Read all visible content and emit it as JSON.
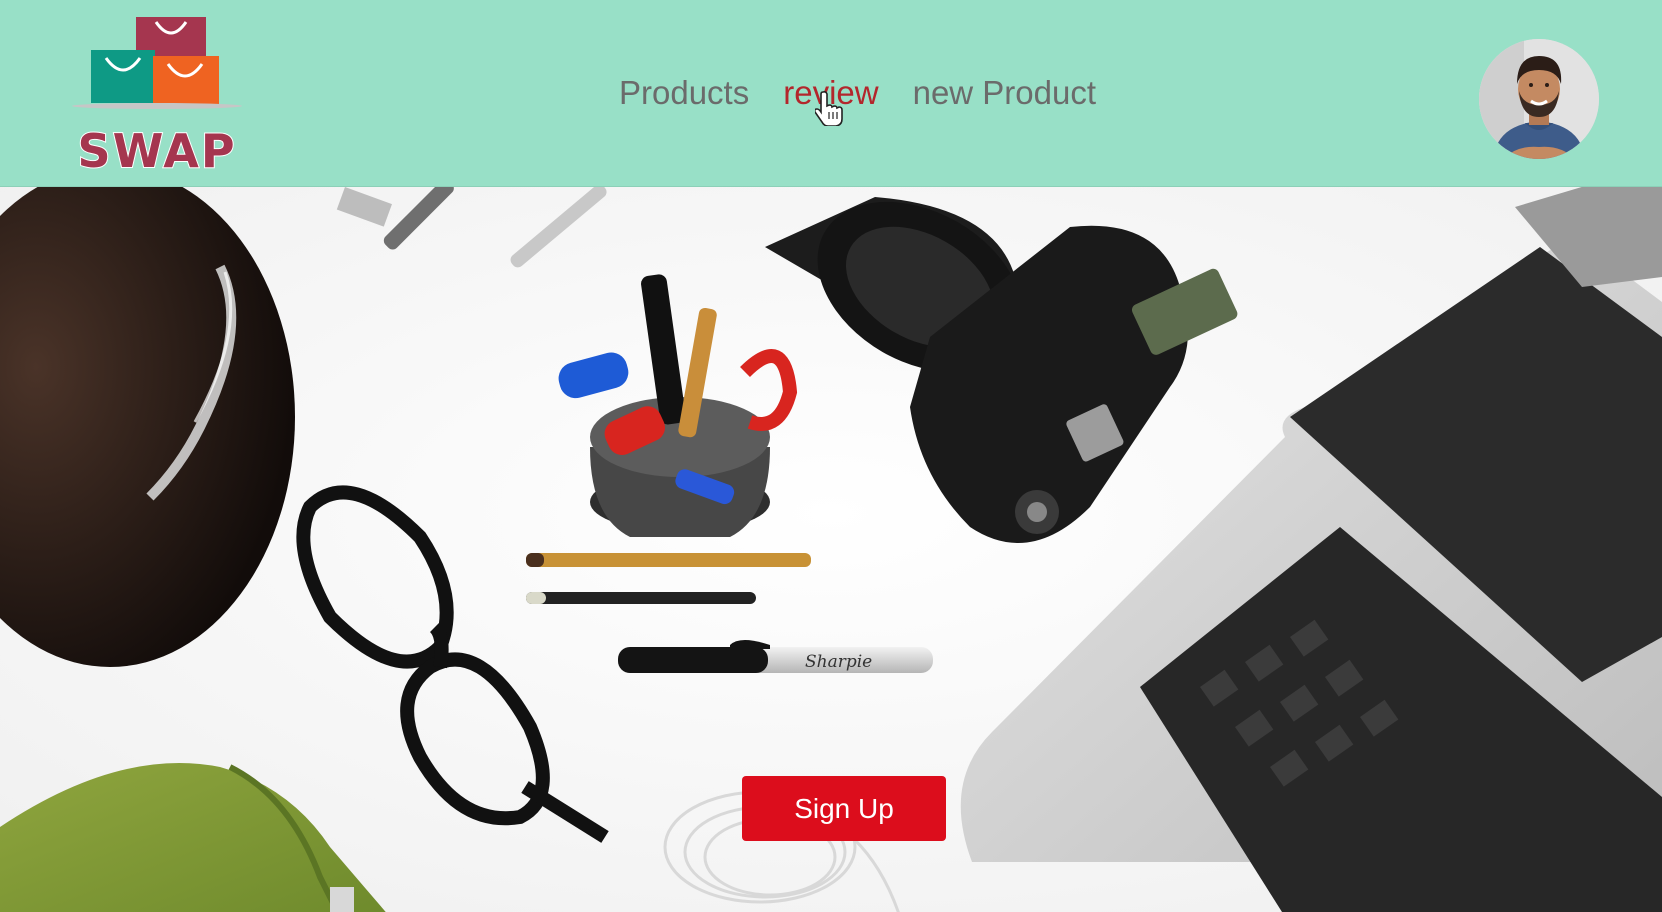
{
  "brand": {
    "logo_text": "SWAP",
    "colors": {
      "maroon": "#a5364f",
      "teal": "#0e9a85",
      "orange": "#ef6321"
    }
  },
  "theme": {
    "navbar_bg": "#98e0c7",
    "link_color": "#6b6b6b",
    "active_link_color": "#b3262c",
    "button_bg": "#dc0d1c"
  },
  "nav": {
    "links": [
      {
        "label": "Products",
        "active": false
      },
      {
        "label": "review",
        "active": true
      },
      {
        "label": "new Product",
        "active": false
      }
    ]
  },
  "user": {
    "avatar_icon": "user-avatar"
  },
  "hero": {
    "image": "desk-flatlay-photo",
    "items": [
      "hat",
      "pens",
      "pencil-cup",
      "camera",
      "laptop",
      "eyeglasses",
      "pencils",
      "marker",
      "green-shirt",
      "earphones"
    ],
    "marker_brand": "Sharpie",
    "signup_label": "Sign Up"
  }
}
